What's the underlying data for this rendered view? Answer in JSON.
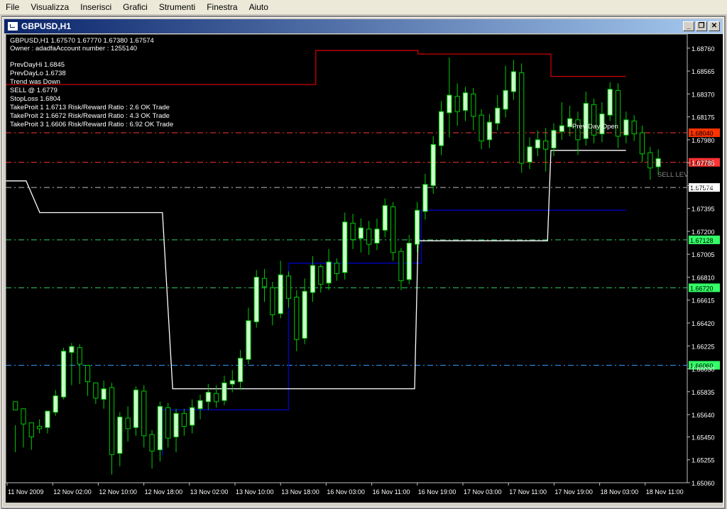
{
  "menu": [
    "File",
    "Visualizza",
    "Inserisci",
    "Grafici",
    "Strumenti",
    "Finestra",
    "Aiuto"
  ],
  "window": {
    "title": "GBPUSD,H1",
    "minimize": "_",
    "restore": "❐",
    "close": "✕"
  },
  "header": {
    "line1": "GBPUSD,H1  1.67570 1.67770 1.67380 1.67574",
    "line2": "Owner : adadfaAccount number : 1255140"
  },
  "info": [
    "PrevDayHi 1.6845",
    "PrevDayLo 1.6738",
    "Trend was Down",
    "SELL @ 1.6779",
    "StopLoss 1.6804",
    "TakeProit 1 1.6713 Risk/Reward Ratio : 2.6 OK Trade",
    "TakeProit 2 1.6672 Risk/Reward Ratio : 4.3 OK Trade",
    "TakeProit 3 1.6606 Risk/Reward Ratio : 6.92 OK Trade"
  ],
  "annotations": {
    "prev_day_open": "Prev Day Open",
    "sell_level": "SELL LEV"
  },
  "colors": {
    "bull": "#ccffcc",
    "bear": "#000000",
    "wick": "#00cc00",
    "prev_hi": "#cc0000",
    "prev_lo": "#0000cc",
    "mid": "#ffffff"
  },
  "chart_data": {
    "type": "candlestick",
    "symbol": "GBPUSD",
    "timeframe": "H1",
    "ylim": [
      1.6506,
      1.6888
    ],
    "y_ticks": [
      "1.68760",
      "1.68565",
      "1.68370",
      "1.68175",
      "1.67980",
      "1.67785",
      "1.67590",
      "1.67395",
      "1.67200",
      "1.67005",
      "1.66810",
      "1.66615",
      "1.66420",
      "1.66225",
      "1.66030",
      "1.65835",
      "1.65640",
      "1.65450",
      "1.65255",
      "1.65060"
    ],
    "x_ticks": [
      "11 Nov 2009",
      "12 Nov 02:00",
      "12 Nov 10:00",
      "12 Nov 18:00",
      "13 Nov 02:00",
      "13 Nov 10:00",
      "13 Nov 18:00",
      "16 Nov 03:00",
      "16 Nov 11:00",
      "16 Nov 19:00",
      "17 Nov 03:00",
      "17 Nov 11:00",
      "17 Nov 19:00",
      "18 Nov 03:00",
      "18 Nov 11:00"
    ],
    "levels": [
      {
        "label": "1.68040",
        "value": 1.6804,
        "color": "#ff3300",
        "line": "#ff3333"
      },
      {
        "label": "1.67788",
        "value": 1.67788,
        "color": "#ff3333",
        "line": "#ff3333"
      },
      {
        "label": "1.67574",
        "value": 1.67574,
        "color": "#ffffff",
        "line": "#bbbbbb"
      },
      {
        "label": "1.67128",
        "value": 1.67128,
        "color": "#33ff66",
        "line": "#33cc66"
      },
      {
        "label": "1.66720",
        "value": 1.6672,
        "color": "#33ff66",
        "line": "#33cc66"
      },
      {
        "label": "1.66060",
        "value": 1.6606,
        "color": "#33ff66",
        "line": "#3399ff"
      }
    ],
    "candles": [
      [
        1.6575,
        1.6568,
        1.6555,
        1.6532
      ],
      [
        1.6569,
        1.6556,
        1.656,
        1.6536
      ],
      [
        1.6557,
        1.6545,
        1.6553,
        1.6534
      ],
      [
        1.6554,
        1.6552,
        1.656,
        1.6548
      ],
      [
        1.6553,
        1.6567,
        1.6565,
        1.6548
      ],
      [
        1.6566,
        1.658,
        1.6585,
        1.6563
      ],
      [
        1.6579,
        1.6618,
        1.6621,
        1.6577
      ],
      [
        1.6617,
        1.6622,
        1.6625,
        1.6589
      ],
      [
        1.6621,
        1.6607,
        1.6624,
        1.659
      ],
      [
        1.6606,
        1.6592,
        1.6604,
        1.658
      ],
      [
        1.6591,
        1.6578,
        1.6588,
        1.6573
      ],
      [
        1.6577,
        1.6586,
        1.6593,
        1.6569
      ],
      [
        1.6587,
        1.653,
        1.6591,
        1.6513
      ],
      [
        1.6531,
        1.6562,
        1.6566,
        1.652
      ],
      [
        1.6561,
        1.6552,
        1.6571,
        1.6541
      ],
      [
        1.6553,
        1.6585,
        1.6588,
        1.6546
      ],
      [
        1.6584,
        1.6546,
        1.6589,
        1.6536
      ],
      [
        1.6547,
        1.6533,
        1.6551,
        1.6518
      ],
      [
        1.6534,
        1.6571,
        1.6575,
        1.6524
      ],
      [
        1.657,
        1.6544,
        1.6574,
        1.6536
      ],
      [
        1.6545,
        1.6565,
        1.6569,
        1.6532
      ],
      [
        1.6565,
        1.6554,
        1.6569,
        1.6546
      ],
      [
        1.6555,
        1.657,
        1.6577,
        1.6548
      ],
      [
        1.6569,
        1.6576,
        1.6581,
        1.656
      ],
      [
        1.6575,
        1.6583,
        1.659,
        1.6568
      ],
      [
        1.6582,
        1.6575,
        1.6589,
        1.657
      ],
      [
        1.6576,
        1.6591,
        1.6597,
        1.6572
      ],
      [
        1.659,
        1.6593,
        1.6602,
        1.6583
      ],
      [
        1.6592,
        1.6612,
        1.6619,
        1.6585
      ],
      [
        1.6611,
        1.6644,
        1.6655,
        1.6607
      ],
      [
        1.6643,
        1.6681,
        1.6687,
        1.6638
      ],
      [
        1.668,
        1.6673,
        1.6688,
        1.666
      ],
      [
        1.6672,
        1.6649,
        1.6677,
        1.664
      ],
      [
        1.665,
        1.6683,
        1.6695,
        1.6646
      ],
      [
        1.6682,
        1.6663,
        1.6686,
        1.6655
      ],
      [
        1.6664,
        1.6628,
        1.667,
        1.6618
      ],
      [
        1.6629,
        1.6669,
        1.668,
        1.6624
      ],
      [
        1.6668,
        1.6691,
        1.6699,
        1.666
      ],
      [
        1.669,
        1.6675,
        1.6692,
        1.6668
      ],
      [
        1.6676,
        1.6694,
        1.6705,
        1.667
      ],
      [
        1.6693,
        1.6684,
        1.6697,
        1.6678
      ],
      [
        1.6685,
        1.6728,
        1.6736,
        1.6679
      ],
      [
        1.6727,
        1.6713,
        1.6735,
        1.6705
      ],
      [
        1.6714,
        1.6723,
        1.6731,
        1.6702
      ],
      [
        1.6722,
        1.6709,
        1.6729,
        1.67
      ],
      [
        1.671,
        1.6722,
        1.6731,
        1.6704
      ],
      [
        1.6721,
        1.6742,
        1.6748,
        1.6715
      ],
      [
        1.6741,
        1.6702,
        1.6745,
        1.6695
      ],
      [
        1.6703,
        1.6678,
        1.6706,
        1.667
      ],
      [
        1.6679,
        1.671,
        1.6717,
        1.6675
      ],
      [
        1.6709,
        1.6738,
        1.6745,
        1.6702
      ],
      [
        1.6737,
        1.676,
        1.6769,
        1.673
      ],
      [
        1.6759,
        1.6794,
        1.6801,
        1.6752
      ],
      [
        1.6793,
        1.6822,
        1.6831,
        1.6785
      ],
      [
        1.6821,
        1.6836,
        1.6868,
        1.68
      ],
      [
        1.6835,
        1.6822,
        1.6846,
        1.681
      ],
      [
        1.6823,
        1.6838,
        1.6843,
        1.6814
      ],
      [
        1.6837,
        1.6818,
        1.6842,
        1.6806
      ],
      [
        1.6819,
        1.6797,
        1.6824,
        1.679
      ],
      [
        1.6798,
        1.6813,
        1.682,
        1.6791
      ],
      [
        1.6812,
        1.6825,
        1.6836,
        1.6806
      ],
      [
        1.6824,
        1.684,
        1.6861,
        1.6817
      ],
      [
        1.6839,
        1.6856,
        1.6866,
        1.6832
      ],
      [
        1.6855,
        1.6778,
        1.6863,
        1.677
      ],
      [
        1.6779,
        1.6792,
        1.68,
        1.6773
      ],
      [
        1.6791,
        1.6798,
        1.6806,
        1.6784
      ],
      [
        1.6797,
        1.679,
        1.6808,
        1.6771
      ],
      [
        1.6791,
        1.6806,
        1.6812,
        1.6784
      ],
      [
        1.6805,
        1.681,
        1.683,
        1.6798
      ],
      [
        1.6809,
        1.6816,
        1.6827,
        1.6801
      ],
      [
        1.6815,
        1.6798,
        1.6822,
        1.6785
      ],
      [
        1.6799,
        1.6829,
        1.6839,
        1.6793
      ],
      [
        1.6828,
        1.6802,
        1.6833,
        1.6795
      ],
      [
        1.6803,
        1.682,
        1.683,
        1.6796
      ],
      [
        1.6819,
        1.6841,
        1.6847,
        1.6814
      ],
      [
        1.684,
        1.6801,
        1.6846,
        1.6791
      ],
      [
        1.6802,
        1.6815,
        1.6822,
        1.6795
      ],
      [
        1.6814,
        1.6803,
        1.6819,
        1.6797
      ],
      [
        1.6804,
        1.6786,
        1.681,
        1.6779
      ],
      [
        1.6787,
        1.6774,
        1.6792,
        1.6764
      ],
      [
        1.6775,
        1.6782,
        1.679,
        1.6768
      ]
    ],
    "prev_hi": [
      [
        0,
        1.6845
      ],
      [
        0.455,
        1.6845
      ],
      [
        0.455,
        1.6874
      ],
      [
        0.605,
        1.6874
      ],
      [
        0.605,
        1.6871
      ],
      [
        0.8,
        1.6871
      ],
      [
        0.8,
        1.6852
      ],
      [
        0.91,
        1.6852
      ]
    ],
    "prev_lo": [
      [
        0.23,
        1.6529
      ],
      [
        0.23,
        1.6568
      ],
      [
        0.415,
        1.6568
      ],
      [
        0.415,
        1.6693
      ],
      [
        0.61,
        1.6693
      ],
      [
        0.61,
        1.6738
      ],
      [
        0.91,
        1.6738
      ]
    ],
    "mid_line": [
      [
        0,
        1.6763
      ],
      [
        0.03,
        1.6763
      ],
      [
        0.05,
        1.6736
      ],
      [
        0.23,
        1.6736
      ],
      [
        0.245,
        1.6586
      ],
      [
        0.41,
        1.6586
      ],
      [
        0.41,
        1.6586
      ],
      [
        0.6,
        1.6586
      ],
      [
        0.605,
        1.6712
      ],
      [
        0.795,
        1.6712
      ],
      [
        0.8,
        1.6789
      ],
      [
        0.91,
        1.6789
      ]
    ]
  }
}
